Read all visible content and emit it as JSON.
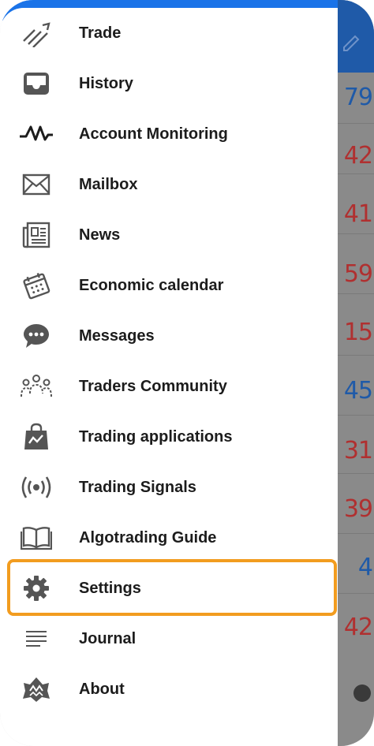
{
  "drawer": {
    "items": [
      {
        "label": "Trade",
        "icon": "trade-icon"
      },
      {
        "label": "History",
        "icon": "history-inbox-icon"
      },
      {
        "label": "Account Monitoring",
        "icon": "monitoring-pulse-icon"
      },
      {
        "label": "Mailbox",
        "icon": "envelope-icon"
      },
      {
        "label": "News",
        "icon": "newspaper-icon"
      },
      {
        "label": "Economic calendar",
        "icon": "calendar-icon"
      },
      {
        "label": "Messages",
        "icon": "chat-bubble-icon"
      },
      {
        "label": "Traders Community",
        "icon": "community-people-icon"
      },
      {
        "label": "Trading applications",
        "icon": "shopping-bag-icon"
      },
      {
        "label": "Trading Signals",
        "icon": "signal-broadcast-icon"
      },
      {
        "label": "Algotrading Guide",
        "icon": "open-book-icon"
      },
      {
        "label": "Settings",
        "icon": "gear-icon"
      },
      {
        "label": "Journal",
        "icon": "lines-icon"
      },
      {
        "label": "About",
        "icon": "about-logo-icon"
      }
    ],
    "highlighted": "Settings"
  },
  "background_quotes": [
    {
      "text": "79",
      "color": "#1f5aa8"
    },
    {
      "text": "42",
      "color": "#b03030"
    },
    {
      "text": "41",
      "color": "#b03030"
    },
    {
      "text": "59",
      "color": "#b03030"
    },
    {
      "text": "15",
      "color": "#b03030"
    },
    {
      "text": "45",
      "color": "#1f5aa8"
    },
    {
      "text": "31",
      "color": "#b03030"
    },
    {
      "text": "39",
      "color": "#b03030"
    },
    {
      "text": "4",
      "color": "#1f5aa8"
    },
    {
      "text": "42",
      "color": "#b03030"
    }
  ],
  "colors": {
    "accent": "#1a73e8",
    "highlight_border": "#f29c1f",
    "icon": "#555555",
    "text": "#1c1c1c"
  }
}
